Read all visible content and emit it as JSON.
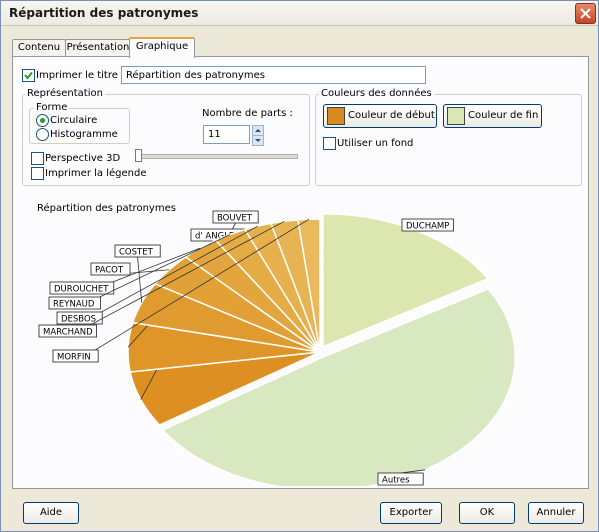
{
  "window": {
    "title": "Répartition des patronymes"
  },
  "tabs": [
    {
      "label": "Contenu"
    },
    {
      "label": "Présentation"
    },
    {
      "label": "Graphique"
    }
  ],
  "title_row": {
    "print_title_label": "Imprimer le titre",
    "print_title_checked": true,
    "title_value": "Répartition des patronymes"
  },
  "representation": {
    "group_label": "Représentation",
    "shape_label": "Forme",
    "options": [
      "Circulaire",
      "Histogramme"
    ],
    "selected": "Circulaire",
    "parts_label": "Nombre de parts :",
    "parts_value": "11",
    "perspective_label": "Perspective 3D",
    "print_legend_label": "Imprimer la légende",
    "perspective_checked": false,
    "print_legend_checked": false
  },
  "colors": {
    "group_label": "Couleurs des données",
    "start_label": "Couleur de début",
    "end_label": "Couleur de fin",
    "start_color": "#d98a1e",
    "end_color": "#d9e8b8",
    "background_label": "Utiliser un fond",
    "background_checked": false
  },
  "chart_data": {
    "type": "pie",
    "title": "Répartition des patronymes",
    "categories": [
      "BOUVET",
      "d' ANGLES",
      "COSTET",
      "PACOT",
      "DUROUCHET",
      "REYNAUD",
      "DESBOS",
      "MARCHAND",
      "MORFIN",
      "DUCHAMP",
      "Autres"
    ],
    "values": [
      7.5,
      6.5,
      5.5,
      4.5,
      3.5,
      3,
      2.5,
      2.5,
      2,
      18,
      54
    ],
    "colors": [
      "#dd8f22",
      "#df9528",
      "#e09b30",
      "#e2a137",
      "#e3a63e",
      "#e5ab45",
      "#e6b04c",
      "#e7b453",
      "#e9b95b",
      "#dce7b0",
      "#d8e8c0"
    ],
    "exploded": [
      "DUCHAMP",
      "Autres"
    ]
  },
  "buttons": {
    "help": "Aide",
    "export": "Exporter",
    "ok": "OK",
    "cancel": "Annuler"
  }
}
